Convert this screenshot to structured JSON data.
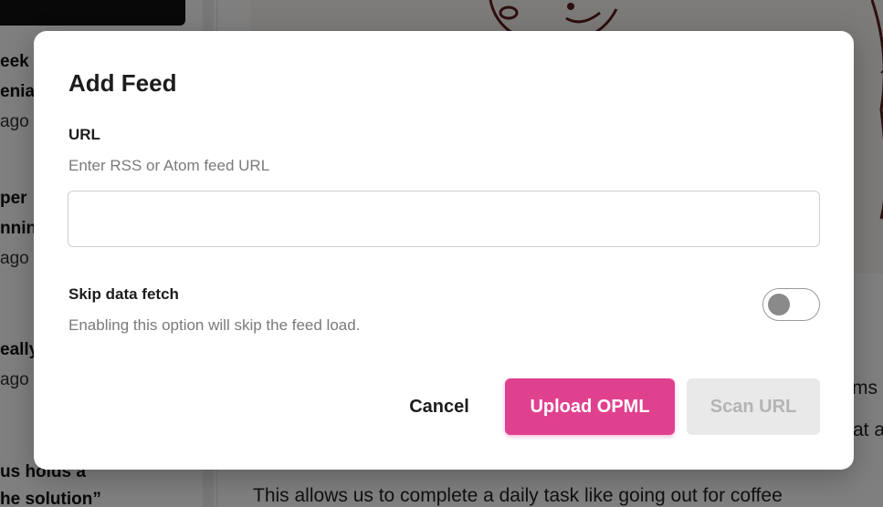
{
  "background": {
    "sidebar": {
      "fragments": [
        {
          "text": "eek",
          "kind": "title"
        },
        {
          "text": "enia",
          "kind": "title"
        },
        {
          "text": "ago",
          "kind": "meta"
        },
        {
          "text": "per",
          "kind": "title"
        },
        {
          "text": "nnin",
          "kind": "title"
        },
        {
          "text": "ago",
          "kind": "meta"
        },
        {
          "text": "eally",
          "kind": "title"
        },
        {
          "text": "ago",
          "kind": "meta"
        },
        {
          "text": "us holds a",
          "kind": "title"
        },
        {
          "text": "he solution”",
          "kind": "title"
        }
      ]
    },
    "content": {
      "fragments": [
        "ms",
        "at a",
        "This allows us to complete a daily task like going out for coffee"
      ]
    }
  },
  "dialog": {
    "title": "Add Feed",
    "url_label": "URL",
    "url_help": "Enter RSS or Atom feed URL",
    "url_value": "",
    "skip_label": "Skip data fetch",
    "skip_help": "Enabling this option will skip the feed load.",
    "skip_enabled": false,
    "buttons": {
      "cancel": "Cancel",
      "upload": "Upload OPML",
      "scan": "Scan URL"
    },
    "colors": {
      "accent": "#e0418f",
      "disabled_bg": "#e9e9e9",
      "disabled_text": "#b4b4b4"
    }
  }
}
